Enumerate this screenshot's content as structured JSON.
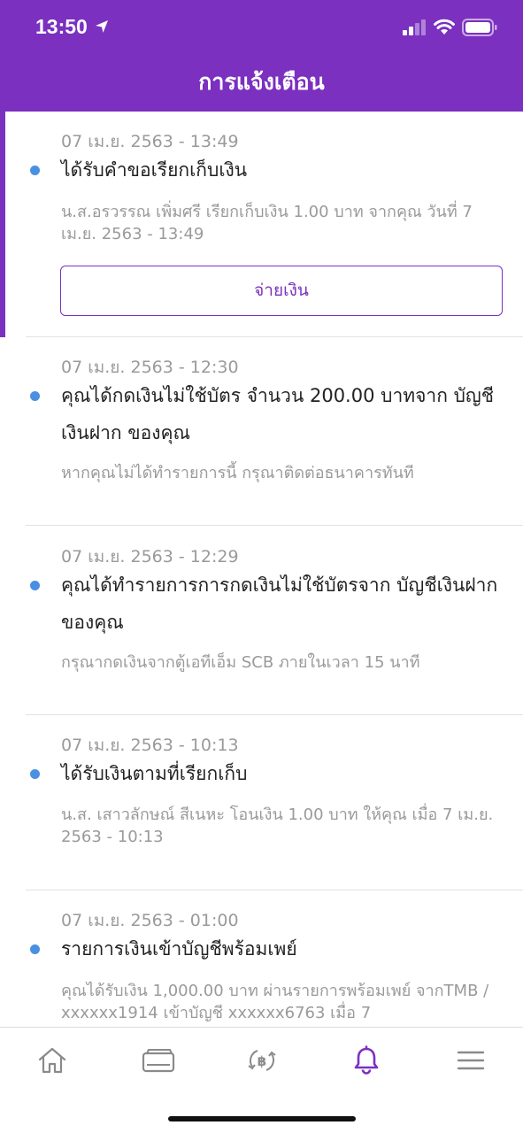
{
  "status_bar": {
    "time": "13:50"
  },
  "header": {
    "title": "การแจ้งเตือน"
  },
  "notifications": [
    {
      "date": "07 เม.ย. 2563 - 13:49",
      "title": "ได้รับคำขอเรียกเก็บเงิน",
      "description": "น.ส.อรวรรณ เพิ่มศรี เรียกเก็บเงิน 1.00 บาท จากคุณ วันที่ 7 เม.ย. 2563 - 13:49",
      "action_label": "จ่ายเงิน",
      "unread": true
    },
    {
      "date": "07 เม.ย. 2563 - 12:30",
      "title": "คุณได้กดเงินไม่ใช้บัตร จำนวน 200.00 บาทจาก บัญชีเงินฝาก ของคุณ",
      "description": "หากคุณไม่ได้ทำรายการนี้ กรุณาติดต่อธนาคารทันที",
      "unread": true
    },
    {
      "date": "07 เม.ย. 2563 - 12:29",
      "title": "คุณได้ทำรายการการกดเงินไม่ใช้บัตรจาก บัญชีเงินฝาก ของคุณ",
      "description": "กรุณากดเงินจากตู้เอทีเอ็ม SCB ภายในเวลา 15 นาที",
      "unread": true
    },
    {
      "date": "07 เม.ย. 2563 - 10:13",
      "title": "ได้รับเงินตามที่เรียกเก็บ",
      "description": "น.ส. เสาวลักษณ์ สีเนหะ  โอนเงิน 1.00 บาท ให้คุณ เมื่อ 7 เม.ย. 2563 - 10:13",
      "unread": true
    },
    {
      "date": "07 เม.ย. 2563 - 01:00",
      "title": "รายการเงินเข้าบัญชีพร้อมเพย์",
      "description": "คุณได้รับเงิน 1,000.00 บาท ผ่านรายการพร้อมเพย์ จากTMB / xxxxxx1914 เข้าบัญชี xxxxxx6763 เมื่อ 7",
      "unread": true
    }
  ],
  "tabs": [
    {
      "icon": "home-icon",
      "active": false
    },
    {
      "icon": "card-icon",
      "active": false
    },
    {
      "icon": "baht-exchange-icon",
      "active": false
    },
    {
      "icon": "bell-icon",
      "active": true
    },
    {
      "icon": "menu-icon",
      "active": false
    }
  ],
  "colors": {
    "accent": "#7b30c0",
    "unread_dot": "#4a90e2",
    "tab_inactive": "#8a8a8a"
  }
}
